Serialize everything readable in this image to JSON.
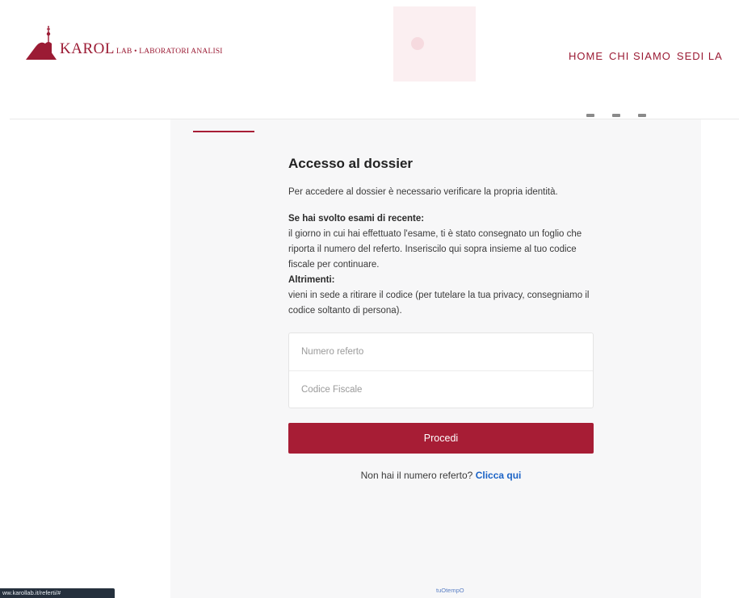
{
  "header": {
    "logo": {
      "brand": "KAROL",
      "subtitle": "LAB • LABORATORI ANALISI"
    },
    "nav": [
      "HOME",
      "CHI SIAMO",
      "SEDI LA"
    ]
  },
  "login": {
    "title": "Accesso al dossier",
    "intro": "Per accedere al dossier è necessario verificare la propria identità.",
    "recent_heading": "Se hai svolto esami di recente:",
    "recent_text": "il giorno in cui hai effettuato l'esame, ti è stato consegnato un foglio che riporta il numero del referto. Inseriscilo qui sopra insieme al tuo codice fiscale per continuare.",
    "otherwise_heading": "Altrimenti:",
    "otherwise_text": "vieni in sede a ritirare il codice (per tutelare la tua privacy, consegniamo il codice soltanto di persona).",
    "fields": {
      "referto_placeholder": "Numero referto",
      "codice_placeholder": "Codice Fiscale"
    },
    "submit_label": "Procedi",
    "help_text": "Non hai il numero referto?",
    "help_link": "Clicca qui"
  },
  "footer": {
    "powered_by": "tuOtempO"
  },
  "statusbar": {
    "url": "ww.karollab.it/referti/#"
  },
  "colors": {
    "brand": "#a71d35",
    "link": "#1b63c6"
  }
}
